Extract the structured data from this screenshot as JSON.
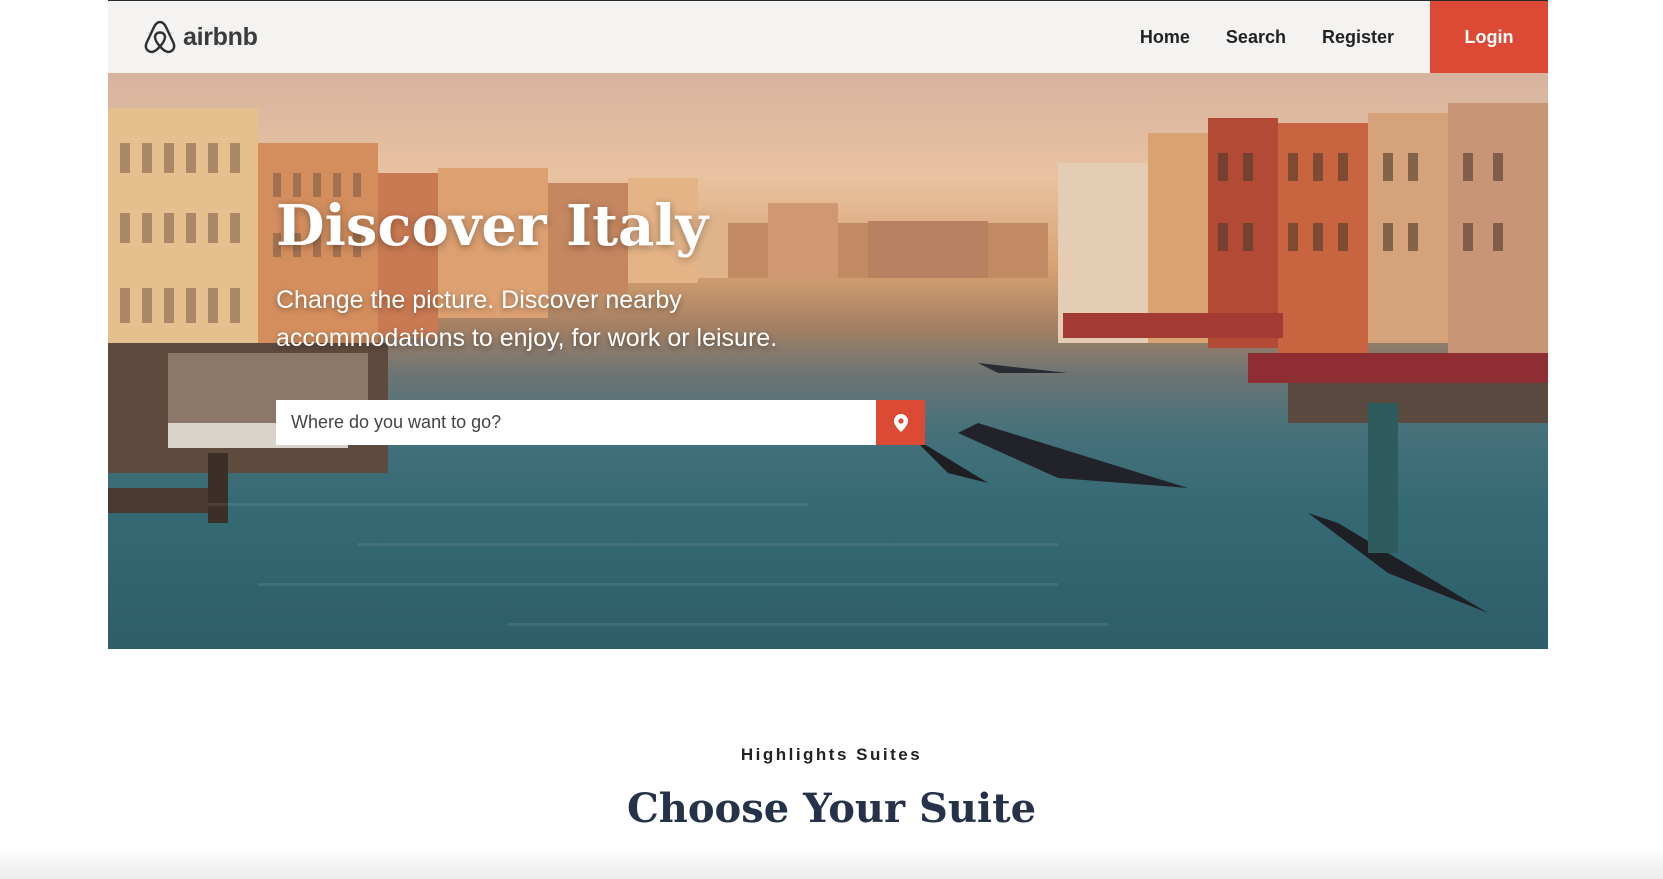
{
  "header": {
    "logo_text": "airbnb",
    "nav": [
      {
        "label": "Home"
      },
      {
        "label": "Search"
      },
      {
        "label": "Register"
      }
    ],
    "login_label": "Login"
  },
  "hero": {
    "title": "Discover Italy",
    "subtitle": "Change the picture. Discover nearby accommodations to enjoy, for work or leisure.",
    "search": {
      "placeholder": "Where do you want to go?",
      "value": "",
      "button_icon": "map-pin-icon"
    }
  },
  "section": {
    "eyebrow": "Highlights Suites",
    "title": "Choose Your Suite"
  },
  "colors": {
    "accent": "#dc4a36",
    "header_bg": "#f4f3f1",
    "title_navy": "#25324a"
  }
}
